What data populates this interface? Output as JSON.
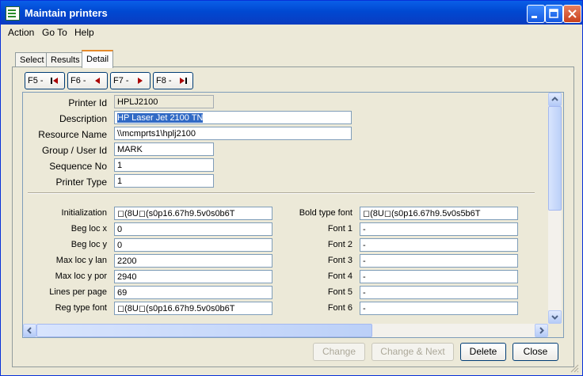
{
  "window": {
    "title": "Maintain printers"
  },
  "menu": [
    "Action",
    "Go To",
    "Help"
  ],
  "tabs": [
    "Select",
    "Results",
    "Detail"
  ],
  "nav": [
    "F5 -",
    "F6 -",
    "F7 -",
    "F8 -"
  ],
  "fields": {
    "printer_id": {
      "label": "Printer Id",
      "value": "HPLJ2100"
    },
    "description": {
      "label": "Description",
      "value": "HP Laser Jet 2100 TN"
    },
    "resource_name": {
      "label": "Resource Name",
      "value": "\\\\mcmprts1\\hplj2100"
    },
    "group_user": {
      "label": "Group / User Id",
      "value": "MARK"
    },
    "sequence_no": {
      "label": "Sequence No",
      "value": "1"
    },
    "printer_type": {
      "label": "Printer Type",
      "value": "1"
    }
  },
  "left_params": [
    {
      "label": "Initialization",
      "value": "◻(8U◻(s0p16.67h9.5v0s0b6T"
    },
    {
      "label": "Beg loc x",
      "value": "0"
    },
    {
      "label": "Beg loc y",
      "value": "0"
    },
    {
      "label": "Max loc y lan",
      "value": "2200"
    },
    {
      "label": "Max loc y por",
      "value": "2940"
    },
    {
      "label": "Lines per page",
      "value": "69"
    },
    {
      "label": "Reg type font",
      "value": "◻(8U◻(s0p16.67h9.5v0s0b6T"
    }
  ],
  "right_params": [
    {
      "label": "Bold type font",
      "value": "◻(8U◻(s0p16.67h9.5v0s5b6T"
    },
    {
      "label": "Font 1",
      "value": "-"
    },
    {
      "label": "Font 2",
      "value": "-"
    },
    {
      "label": "Font 3",
      "value": "-"
    },
    {
      "label": "Font 4",
      "value": "-"
    },
    {
      "label": "Font 5",
      "value": "-"
    },
    {
      "label": "Font 6",
      "value": "-"
    }
  ],
  "buttons": {
    "change": "Change",
    "change_next": "Change & Next",
    "delete": "Delete",
    "close": "Close"
  }
}
